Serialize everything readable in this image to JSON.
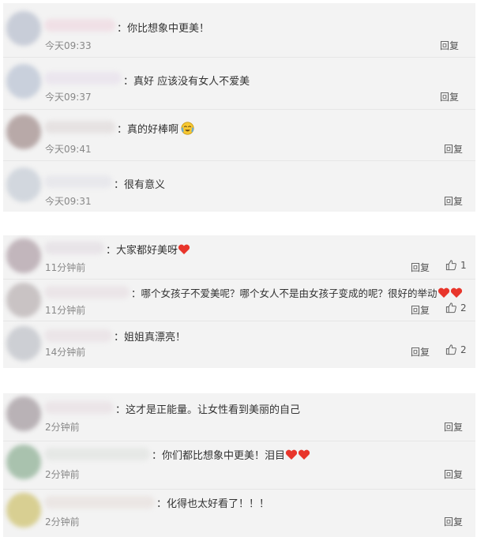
{
  "panels": [
    {
      "comments": [
        {
          "text": "：你比想象中更美！",
          "time": "今天09:33",
          "reply": "回复"
        },
        {
          "text": "：真好 应该没有女人不爱美",
          "time": "今天09:37",
          "reply": "回复"
        },
        {
          "text": "：真的好棒啊",
          "time": "今天09:41",
          "reply": "回复",
          "emoji": "laughing-tears-emoji"
        },
        {
          "text": "：很有意义",
          "time": "今天09:31",
          "reply": "回复"
        }
      ]
    },
    {
      "comments": [
        {
          "text": "：大家都好美呀",
          "time": "11分钟前",
          "reply": "回复",
          "likes": "1",
          "hearts": 1
        },
        {
          "text": "：哪个女孩子不爱美呢？哪个女人不是由女孩子变成的呢？很好的举动",
          "time": "11分钟前",
          "reply": "回复",
          "likes": "2",
          "hearts": 2
        },
        {
          "text": "：姐姐真漂亮！",
          "time": "14分钟前",
          "reply": "回复",
          "likes": "2"
        }
      ]
    },
    {
      "comments": [
        {
          "text": "：这才是正能量。让女性看到美丽的自己",
          "time": "2分钟前",
          "reply": "回复"
        },
        {
          "text": "：你们都比想象中更美！泪目",
          "time": "2分钟前",
          "reply": "回复",
          "hearts": 2
        },
        {
          "text": "：化得也太好看了！！！",
          "time": "2分钟前",
          "reply": "回复"
        }
      ]
    }
  ],
  "colors": {
    "panel_bg": "#f3f3f3",
    "heart": "#e8352b"
  }
}
